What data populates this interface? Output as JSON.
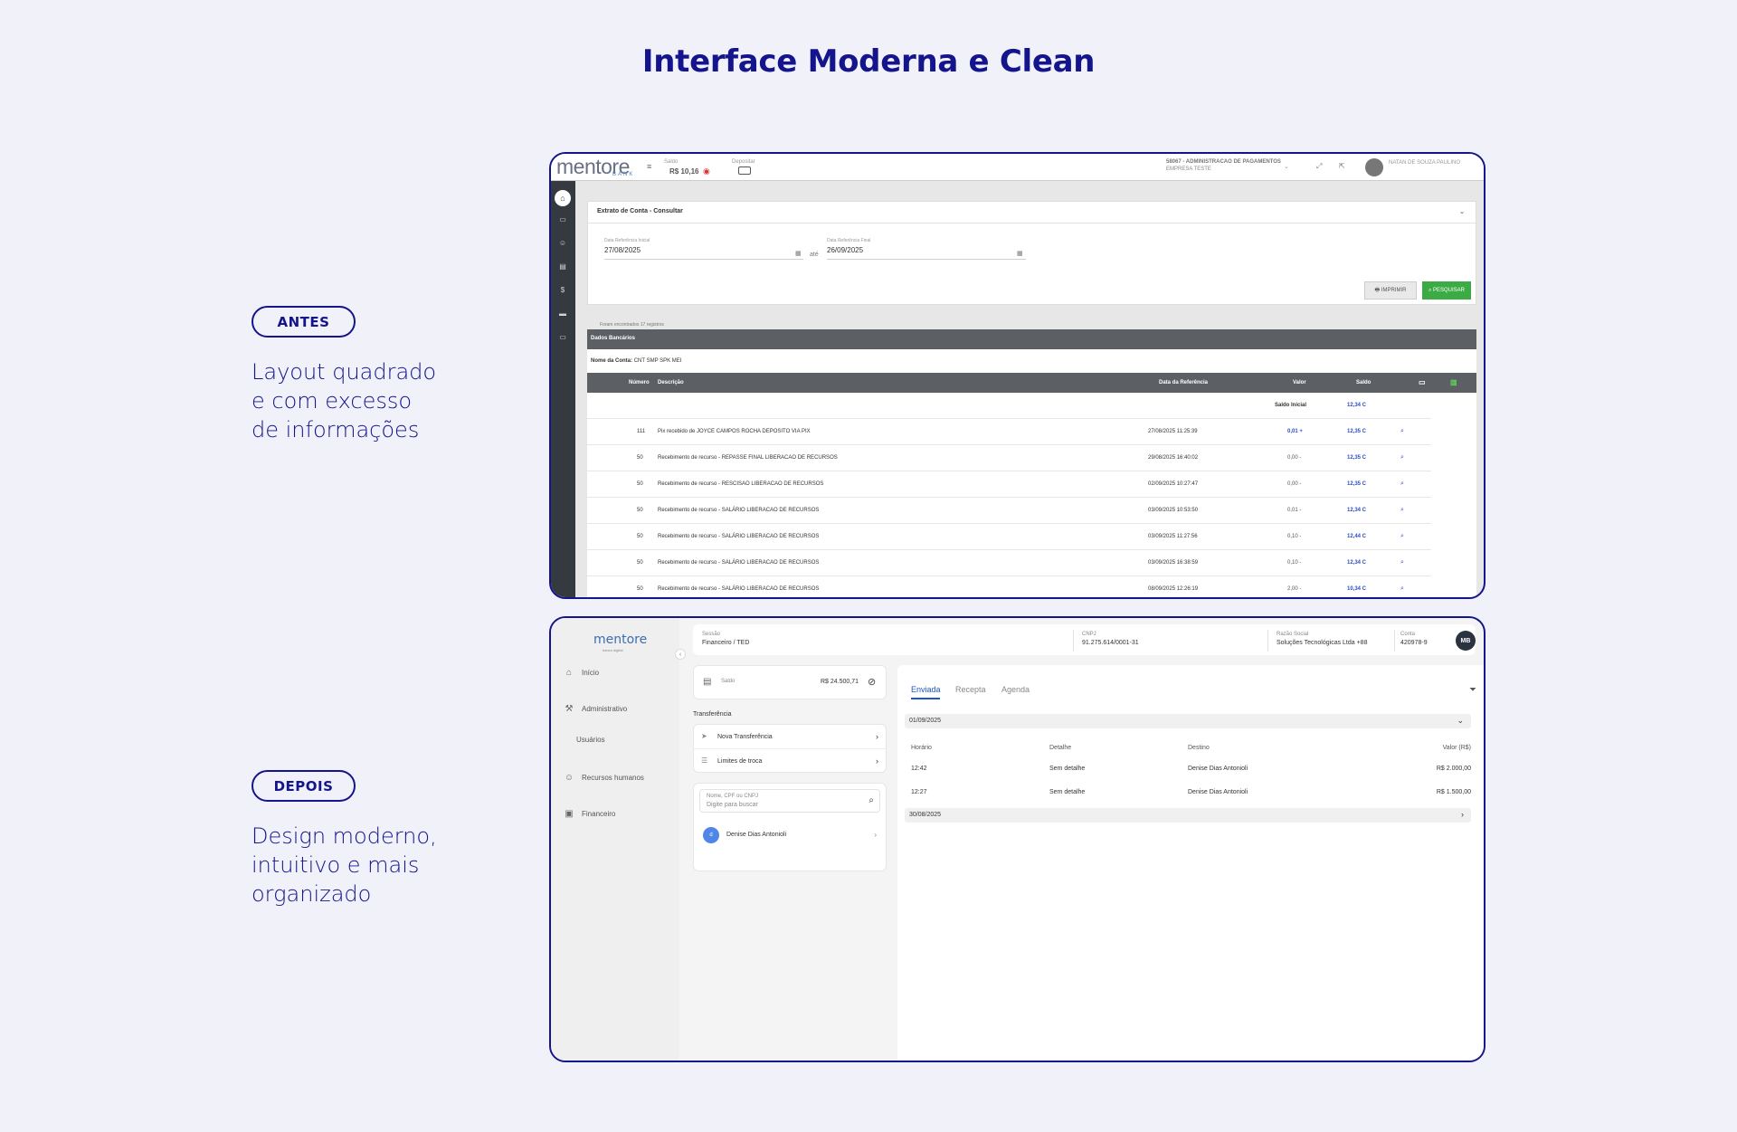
{
  "page": {
    "title": "Interface Moderna e Clean",
    "before": {
      "tag": "ANTES",
      "lines": [
        "Layout quadrado",
        "e com excesso",
        "de informações"
      ]
    },
    "after": {
      "tag": "DEPOIS",
      "lines": [
        "Design moderno,",
        "intuitivo e mais",
        "organizado"
      ]
    }
  },
  "old_ui": {
    "logo": "mentore",
    "logo_sub": "BANK",
    "saldo_label": "Saldo",
    "saldo_value": "R$ 10,16",
    "depositar_label": "Depositar",
    "company_line1": "58067 - ADMINISTRACAO DE PAGAMENTOS",
    "company_line2": "EMPRESA TESTE",
    "user_name": "NATAN DE SOUZA PAULINO",
    "panel_title": "Extrato de Conta - Consultar",
    "date_start_label": "Data Referência Inicial",
    "date_start": "27/08/2025",
    "ate": "até",
    "date_end_label": "Data Referência Final",
    "date_end": "26/09/2025",
    "btn_print": "IMPRIMIR",
    "btn_search": "PESQUISAR",
    "found": "Foram encontrados 17 registros",
    "dados_bancarios": "Dados Bancários",
    "nome_conta_label": "Nome da Conta:",
    "nome_conta": "CNT SMP SPK MEI",
    "columns": {
      "numero": "Número",
      "descricao": "Descrição",
      "data": "Data da Referência",
      "valor": "Valor",
      "saldo": "Saldo"
    },
    "saldo_inicial_label": "Saldo Inicial",
    "saldo_inicial": "12,34 C",
    "rows": [
      {
        "num": "111",
        "desc": "Pix recebido de JOYCE CAMPOS ROCHA DEPOSITO VIA PIX",
        "date": "27/08/2025 11:25:39",
        "valor": "0,01 +",
        "saldo": "12,35 C"
      },
      {
        "num": "50",
        "desc": "Recebimento de recurso - REPASSE FINAL LIBERACAO DE RECURSOS",
        "date": "29/08/2025 16:40:02",
        "valor": "0,00 -",
        "saldo": "12,35 C"
      },
      {
        "num": "50",
        "desc": "Recebimento de recurso - RESCISAO LIBERACAO DE RECURSOS",
        "date": "02/09/2025 10:27:47",
        "valor": "0,00 -",
        "saldo": "12,35 C"
      },
      {
        "num": "50",
        "desc": "Recebimento de recurso - SALÁRIO LIBERACAO DE RECURSOS",
        "date": "03/09/2025 10:53:50",
        "valor": "0,01 -",
        "saldo": "12,34 C"
      },
      {
        "num": "50",
        "desc": "Recebimento de recurso - SALÁRIO LIBERACAO DE RECURSOS",
        "date": "03/09/2025 11:27:56",
        "valor": "0,10 -",
        "saldo": "12,44 C"
      },
      {
        "num": "50",
        "desc": "Recebimento de recurso - SALÁRIO LIBERACAO DE RECURSOS",
        "date": "03/09/2025 16:38:59",
        "valor": "0,10 -",
        "saldo": "12,34 C"
      },
      {
        "num": "50",
        "desc": "Recebimento de recurso - SALÁRIO LIBERACAO DE RECURSOS",
        "date": "08/09/2025 12:26:19",
        "valor": "2,00 -",
        "saldo": "10,34 C"
      }
    ]
  },
  "new_ui": {
    "logo": "mentore",
    "logo_sub": "banco digital",
    "nav": {
      "inicio": "Início",
      "administrativo": "Administrativo",
      "usuarios": "Usuários",
      "rh": "Recursos humanos",
      "financeiro": "Financeiro"
    },
    "top": {
      "sessao_label": "Sessão",
      "sessao": "Financeiro / TED",
      "cnpj_label": "CNPJ",
      "cnpj": "91.275.614/0001-31",
      "razao_label": "Razão Social",
      "razao": "Soluções Tecnológicas Ltda +88",
      "conta_label": "Conta",
      "conta": "420978-9",
      "avatar": "MB"
    },
    "saldo_label": "Saldo",
    "saldo_value": "R$ 24.500,71",
    "transferencia": "Transferência",
    "nova_transferencia": "Nova Transferência",
    "limites": "Limites de troca",
    "search_label": "Nome, CPF ou CNPJ",
    "search_placeholder": "Digite para buscar",
    "contact_initial": "d",
    "contact_name": "Denise Dias Antonioli",
    "tabs": [
      "Enviada",
      "Recepta",
      "Agenda"
    ],
    "group1_date": "01/09/2025",
    "group2_date": "30/08/2025",
    "cols": {
      "horario": "Horário",
      "detalhe": "Detalhe",
      "destino": "Destino",
      "valor": "Valor (R$)"
    },
    "rows": [
      {
        "time": "12:42",
        "detail": "Sem detalhe",
        "dest": "Denise Dias Antonioli",
        "value": "R$ 2.000,00"
      },
      {
        "time": "12:27",
        "detail": "Sem detalhe",
        "dest": "Denise Dias Antonioli",
        "value": "R$ 1.500,00"
      }
    ]
  }
}
